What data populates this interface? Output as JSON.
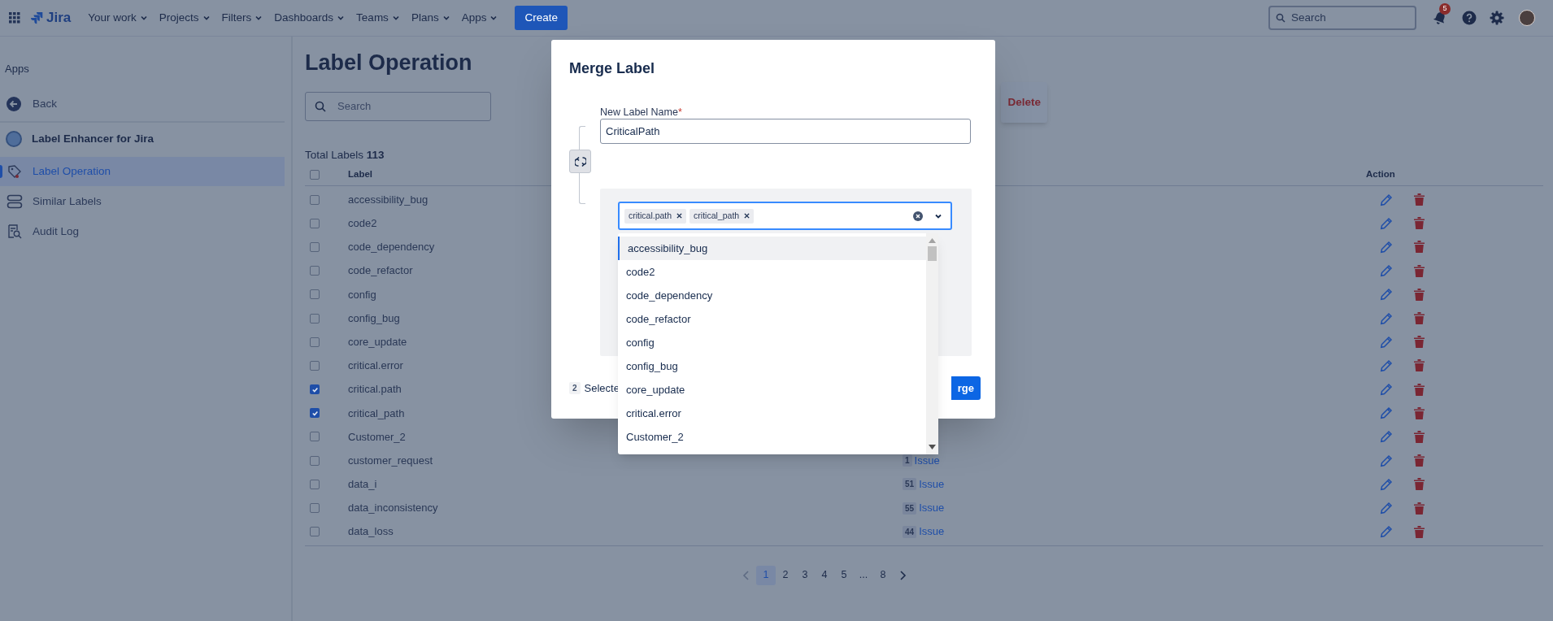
{
  "topbar": {
    "product": "Jira",
    "nav": [
      {
        "label": "Your work",
        "dropdown": true
      },
      {
        "label": "Projects",
        "dropdown": true
      },
      {
        "label": "Filters",
        "dropdown": true
      },
      {
        "label": "Dashboards",
        "dropdown": true
      },
      {
        "label": "Teams",
        "dropdown": true
      },
      {
        "label": "Plans",
        "dropdown": true
      },
      {
        "label": "Apps",
        "dropdown": true
      }
    ],
    "create_button": "Create",
    "search": {
      "placeholder": "Search"
    },
    "notifications_badge": "5"
  },
  "sidebar": {
    "heading": "Apps",
    "back": "Back",
    "app_name": "Label Enhancer for Jira",
    "items": [
      {
        "label": "Label Operation",
        "kind": "tag",
        "selected": true
      },
      {
        "label": "Similar Labels",
        "kind": "stack",
        "selected": false
      },
      {
        "label": "Audit Log",
        "kind": "audit",
        "selected": false
      }
    ]
  },
  "page": {
    "title": "Label Operation",
    "search": {
      "placeholder": "Search"
    },
    "delete_button": "Delete",
    "total_label": "Total Labels",
    "total_count": "113"
  },
  "table": {
    "select_all_checked": false,
    "columns": [
      "Label",
      "Action"
    ],
    "rows": [
      {
        "label": "accessibility_bug",
        "checked": false
      },
      {
        "label": "code2",
        "checked": false
      },
      {
        "label": "code_dependency",
        "checked": false
      },
      {
        "label": "code_refactor",
        "checked": false
      },
      {
        "label": "config",
        "checked": false
      },
      {
        "label": "config_bug",
        "checked": false
      },
      {
        "label": "core_update",
        "checked": false
      },
      {
        "label": "critical.error",
        "checked": false
      },
      {
        "label": "critical.path",
        "checked": true
      },
      {
        "label": "critical_path",
        "checked": true
      },
      {
        "label": "Customer_2",
        "checked": false
      },
      {
        "label": "customer_request",
        "checked": false,
        "issues": {
          "count": "1",
          "text": "Issue"
        }
      },
      {
        "label": "data_i",
        "checked": false,
        "issues": {
          "count": "51",
          "text": "Issue"
        }
      },
      {
        "label": "data_inconsistency",
        "checked": false,
        "issues": {
          "count": "55",
          "text": "Issue"
        }
      },
      {
        "label": "data_loss",
        "checked": false,
        "issues": {
          "count": "44",
          "text": "Issue"
        }
      }
    ]
  },
  "pagination": {
    "pages": [
      {
        "label": "1",
        "selected": true
      },
      {
        "label": "2",
        "selected": false
      },
      {
        "label": "3",
        "selected": false
      },
      {
        "label": "4",
        "selected": false
      },
      {
        "label": "5",
        "selected": false
      },
      {
        "label": "...",
        "selected": false
      },
      {
        "label": "8",
        "selected": false
      }
    ]
  },
  "modal": {
    "title": "Merge Label",
    "field_label": "New Label Name",
    "required_mark": "*",
    "value": "CriticalPath",
    "tags": [
      "critical.path",
      "critical_path"
    ],
    "options": [
      {
        "label": "accessibility_bug",
        "highlighted": true
      },
      {
        "label": "code2",
        "highlighted": false
      },
      {
        "label": "code_dependency",
        "highlighted": false
      },
      {
        "label": "code_refactor",
        "highlighted": false
      },
      {
        "label": "config",
        "highlighted": false
      },
      {
        "label": "config_bug",
        "highlighted": false
      },
      {
        "label": "core_update",
        "highlighted": false
      },
      {
        "label": "critical.error",
        "highlighted": false
      },
      {
        "label": "Customer_2",
        "highlighted": false
      }
    ],
    "selected_count": "2",
    "selected_text": "Selecte",
    "merge_button": "rge"
  }
}
